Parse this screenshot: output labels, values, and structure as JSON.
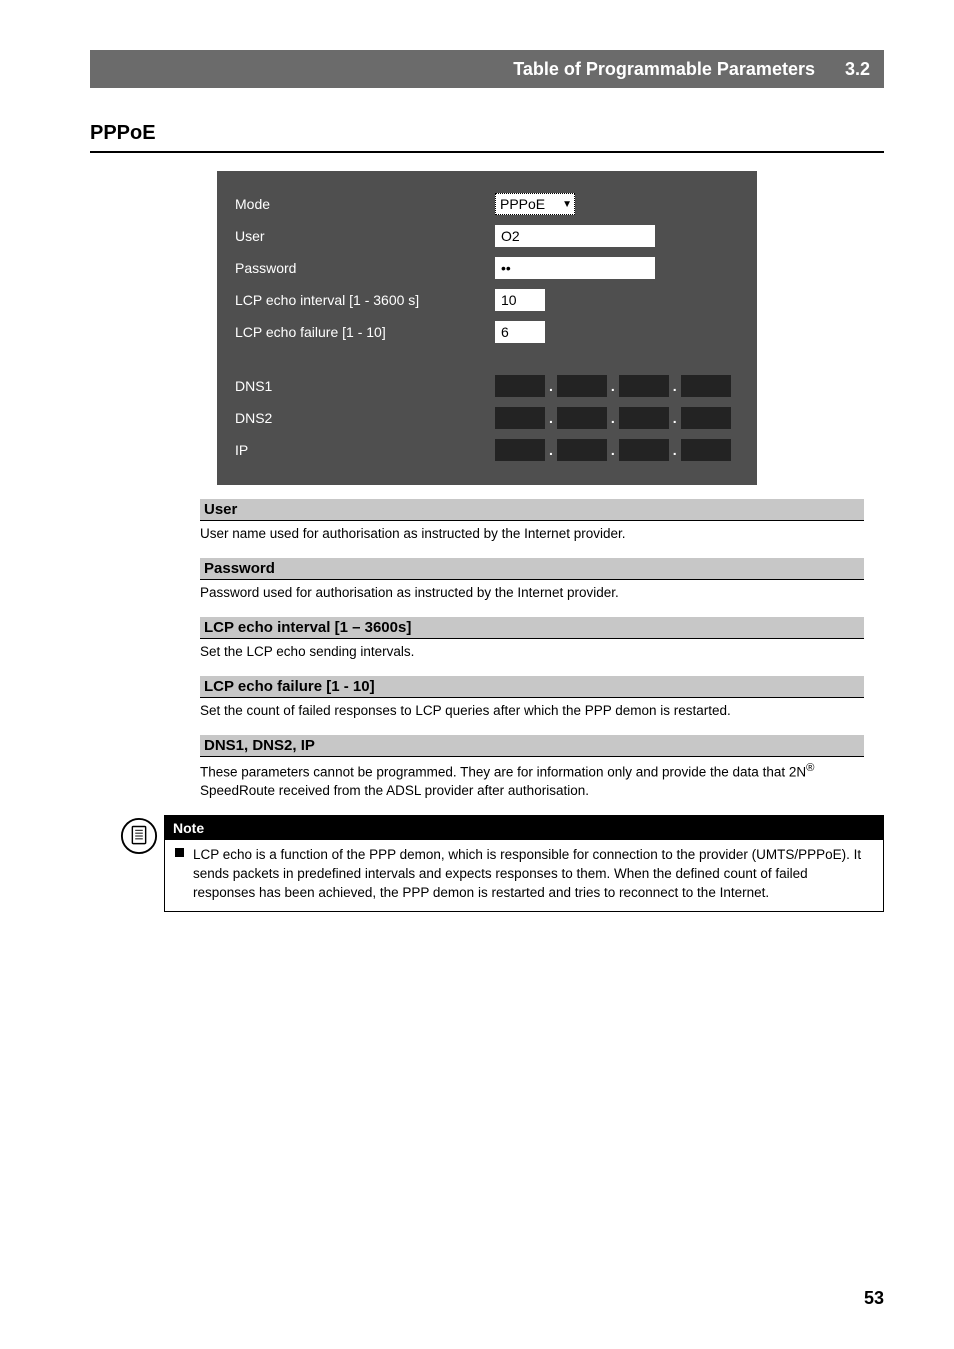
{
  "header": {
    "title": "Table of Programmable Parameters",
    "number": "3.2"
  },
  "section_title": "PPPoE",
  "screenshot": {
    "rows": {
      "mode": {
        "label": "Mode",
        "value": "PPPoE"
      },
      "user": {
        "label": "User",
        "value": "O2"
      },
      "password": {
        "label": "Password",
        "value": "••"
      },
      "lcp_interval": {
        "label": "LCP echo interval [1 - 3600 s]",
        "value": "10"
      },
      "lcp_failure": {
        "label": "LCP echo failure [1 - 10]",
        "value": "6"
      },
      "dns1": {
        "label": "DNS1"
      },
      "dns2": {
        "label": "DNS2"
      },
      "ip": {
        "label": "IP"
      }
    }
  },
  "params": {
    "user": {
      "title": "User",
      "body": "User name used for authorisation as instructed by the Internet provider."
    },
    "password": {
      "title": "Password",
      "body": "Password used for authorisation as instructed by the Internet provider."
    },
    "lcp_interval": {
      "title": "LCP echo interval [1 – 3600s]",
      "body": "Set the LCP echo sending intervals."
    },
    "lcp_failure": {
      "title": "LCP echo failure [1 - 10]",
      "body": "Set the count of failed responses to LCP queries after which the PPP demon is restarted."
    },
    "dns_ip": {
      "title": "DNS1, DNS2, IP",
      "body_pre": "These parameters cannot be programmed. They are for information only and provide the data that 2N",
      "body_sup": "®",
      "body_post": " SpeedRoute received from the ADSL provider after authorisation."
    }
  },
  "note": {
    "title": "Note",
    "body": "LCP echo is a function of the PPP demon, which is responsible for connection to the provider (UMTS/PPPoE). It sends packets in predefined intervals and expects responses to them. When the defined count of failed responses has been achieved, the PPP demon is restarted and tries to reconnect to the Internet."
  },
  "page_number": "53"
}
